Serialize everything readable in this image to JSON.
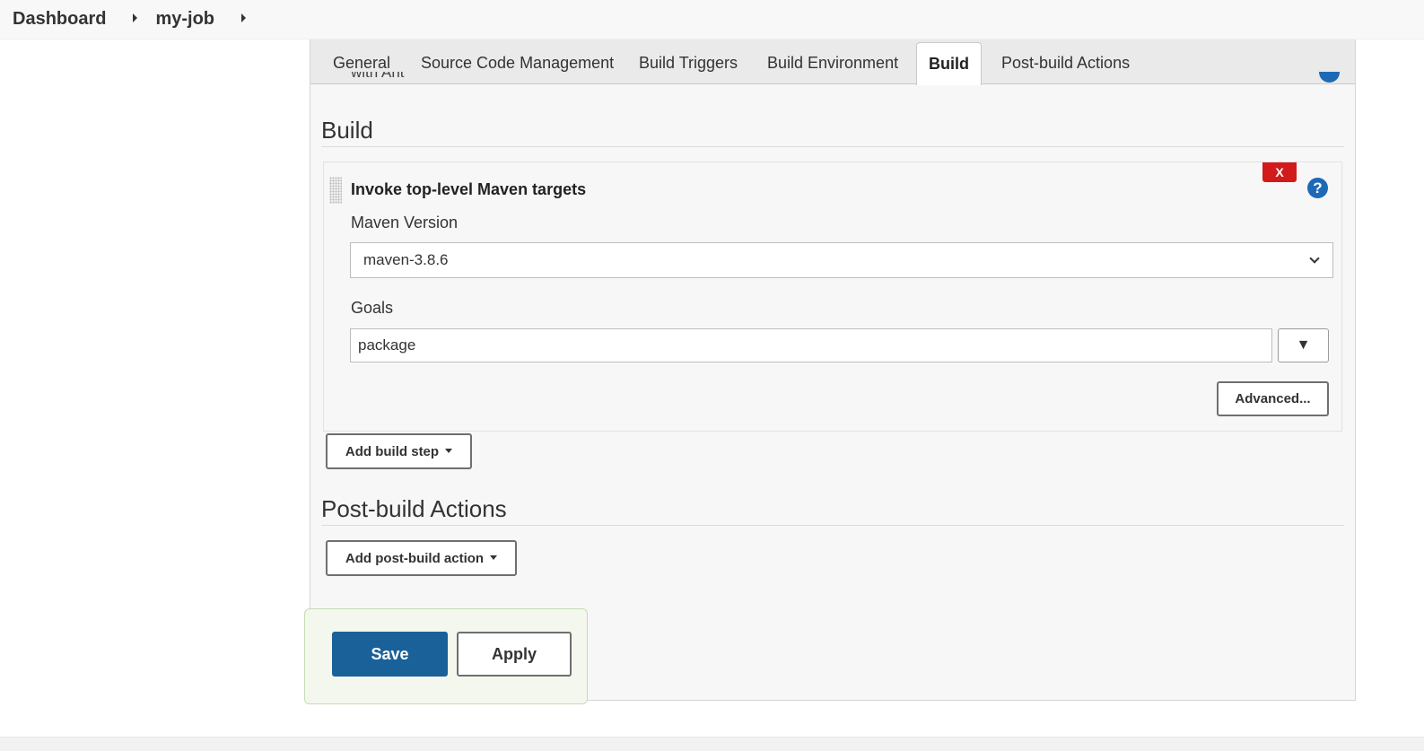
{
  "breadcrumb": {
    "items": [
      "Dashboard",
      "my-job"
    ]
  },
  "tabs": [
    {
      "label": "General",
      "active": false
    },
    {
      "label": "Source Code Management",
      "active": false
    },
    {
      "label": "Build Triggers",
      "active": false
    },
    {
      "label": "Build Environment",
      "active": false
    },
    {
      "label": "Build",
      "active": true
    },
    {
      "label": "Post-build Actions",
      "active": false
    }
  ],
  "build_section": {
    "title": "Build",
    "clipped_text": "with Ant",
    "step": {
      "title": "Invoke top-level Maven targets",
      "remove_label": "X",
      "help_label": "?",
      "maven_version_label": "Maven Version",
      "maven_version_value": "maven-3.8.6",
      "goals_label": "Goals",
      "goals_value": "package",
      "expand_label": "▼",
      "advanced_label": "Advanced..."
    },
    "add_step_label": "Add build step"
  },
  "post_build_section": {
    "title": "Post-build Actions",
    "add_action_label": "Add post-build action"
  },
  "actions": {
    "save_label": "Save",
    "apply_label": "Apply"
  },
  "colors": {
    "primary": "#1a6199",
    "danger": "#d21a1a",
    "help": "#1d69b5"
  }
}
